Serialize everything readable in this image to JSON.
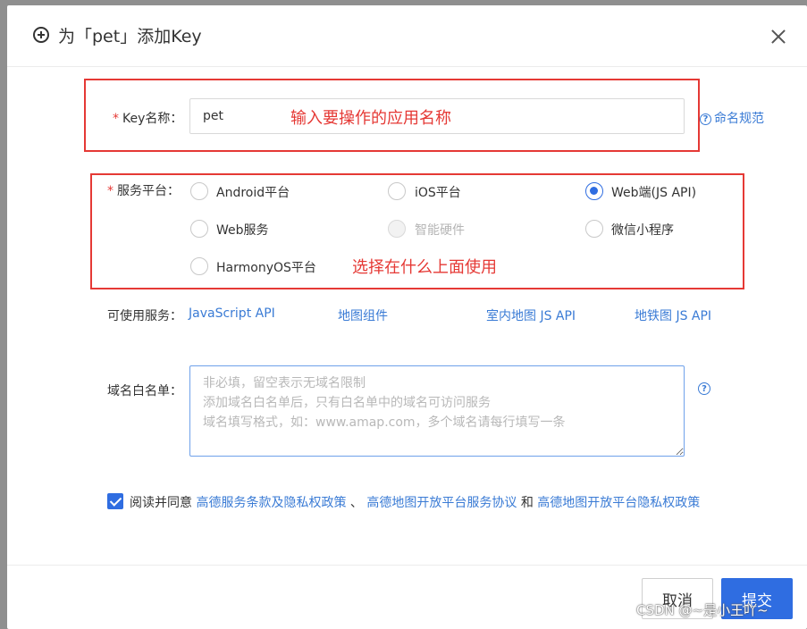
{
  "dialog": {
    "title": "为「pet」添加Key",
    "close_label": "×"
  },
  "form": {
    "key_name": {
      "label": "Key名称：",
      "required_mark": "*",
      "value": "pet",
      "help_link": "命名规范"
    },
    "platform": {
      "label": "服务平台：",
      "required_mark": "*",
      "options": [
        {
          "label": "Android平台",
          "checked": false,
          "disabled": false
        },
        {
          "label": "iOS平台",
          "checked": false,
          "disabled": false
        },
        {
          "label": "Web端(JS API)",
          "checked": true,
          "disabled": false
        },
        {
          "label": "Web服务",
          "checked": false,
          "disabled": false
        },
        {
          "label": "智能硬件",
          "checked": false,
          "disabled": true
        },
        {
          "label": "微信小程序",
          "checked": false,
          "disabled": false
        },
        {
          "label": "HarmonyOS平台",
          "checked": false,
          "disabled": false
        }
      ]
    },
    "services": {
      "label": "可使用服务：",
      "links": [
        "JavaScript API",
        "地图组件",
        "室内地图 JS API",
        "地铁图 JS API"
      ]
    },
    "domain_whitelist": {
      "label": "域名白名单：",
      "placeholder": "非必填，留空表示无域名限制\n添加域名白名单后，只有白名单中的域名可访问服务\n域名填写格式，如：www.amap.com，多个域名请每行填写一条",
      "value": ""
    },
    "agreement": {
      "checked": true,
      "prefix": "阅读并同意",
      "link1": "高德服务条款及隐私权政策",
      "separator": "、",
      "link2": "高德地图开放平台服务协议",
      "conjunction": "和",
      "link3": "高德地图开放平台隐私权政策"
    }
  },
  "annotations": {
    "key_name_note": "输入要操作的应用名称",
    "platform_note": "选择在什么上面使用",
    "color": "#e53935"
  },
  "footer": {
    "cancel_label": "取消",
    "submit_label": "提交"
  },
  "watermark": "CSDN @~是小王吖~",
  "colors": {
    "accent": "#2f6de1",
    "link": "#3a7bd5",
    "annotation": "#e53935"
  }
}
